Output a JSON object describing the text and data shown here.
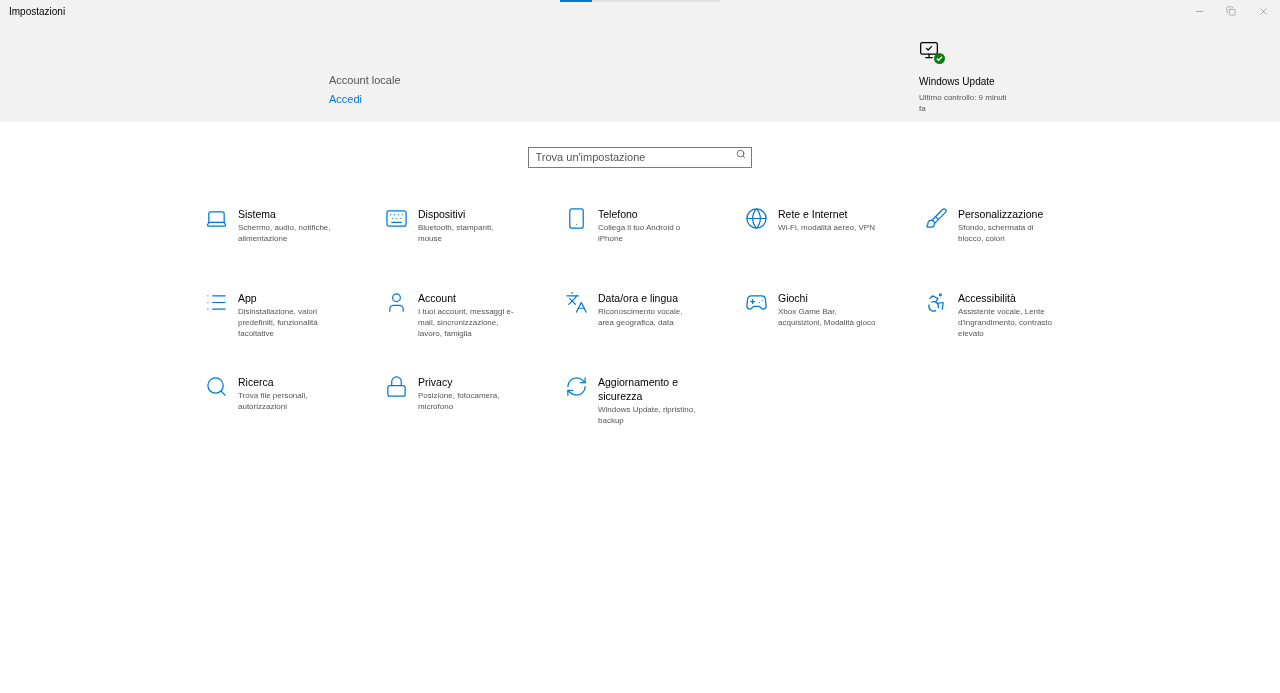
{
  "window": {
    "title": "Impostazioni"
  },
  "loading_bar": {
    "level": 0.2
  },
  "account": {
    "name": "Account locale",
    "link": "Accedi"
  },
  "update": {
    "title": "Windows Update",
    "status": "Ultimo controllo: 9 minuti fa"
  },
  "search": {
    "placeholder": "Trova un'impostazione"
  },
  "categories": [
    {
      "title": "Sistema",
      "description": "Schermo, audio, notifiche, alimentazione"
    },
    {
      "title": "Dispositivi",
      "description": "Bluetooth, stampanti, mouse"
    },
    {
      "title": "Telefono",
      "description": "Collega il tuo Android o iPhone"
    },
    {
      "title": "Rete e Internet",
      "description": "Wi-Fi, modalità aereo, VPN"
    },
    {
      "title": "Personalizzazione",
      "description": "Sfondo, schermata di blocco, colori"
    },
    {
      "title": "App",
      "description": "Disinstallazione, valori predefiniti, funzionalità facoltative"
    },
    {
      "title": "Account",
      "description": "I tuoi account, messaggi e-mail, sincronizzazione, lavoro, famiglia"
    },
    {
      "title": "Data/ora e lingua",
      "description": "Riconoscimento vocale, area geografica, data"
    },
    {
      "title": "Giochi",
      "description": "Xbox Game Bar, acquisizioni, Modalità gioco"
    },
    {
      "title": "Accessibilità",
      "description": "Assistente vocale, Lente d'ingrandimento, contrasto elevato"
    },
    {
      "title": "Ricerca",
      "description": "Trova file personali, autorizzazioni"
    },
    {
      "title": "Privacy",
      "description": "Posizione, fotocamera, microfono"
    },
    {
      "title": "Aggiornamento e sicurezza",
      "description": "Windows Update, ripristino, backup"
    }
  ]
}
